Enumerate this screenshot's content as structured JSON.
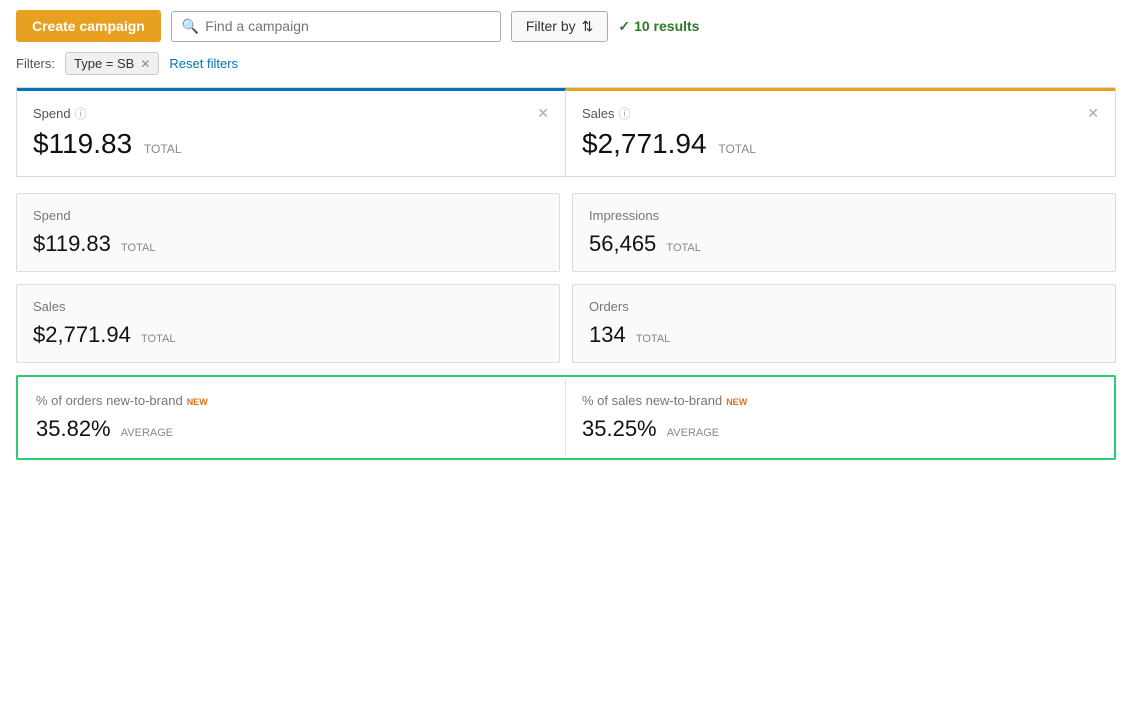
{
  "topbar": {
    "create_btn": "Create campaign",
    "search_placeholder": "Find a campaign",
    "filter_btn": "Filter by",
    "filter_icon": "⇅",
    "results_count": "10 results"
  },
  "filters": {
    "label": "Filters:",
    "active_filter": "Type = SB",
    "reset_label": "Reset filters"
  },
  "summary_cards": [
    {
      "title": "Spend",
      "value": "$119.83",
      "unit": "TOTAL"
    },
    {
      "title": "Sales",
      "value": "$2,771.94",
      "unit": "TOTAL"
    }
  ],
  "metric_cards": [
    {
      "title": "Spend",
      "value": "$119.83",
      "unit": "TOTAL"
    },
    {
      "title": "Impressions",
      "value": "56,465",
      "unit": "TOTAL"
    },
    {
      "title": "Sales",
      "value": "$2,771.94",
      "unit": "TOTAL"
    },
    {
      "title": "Orders",
      "value": "134",
      "unit": "TOTAL"
    }
  ],
  "ntb_cards": [
    {
      "title": "% of orders new-to-brand",
      "badge": "NEW",
      "value": "35.82%",
      "unit": "AVERAGE"
    },
    {
      "title": "% of sales new-to-brand",
      "badge": "NEW",
      "value": "35.25%",
      "unit": "AVERAGE"
    }
  ],
  "colors": {
    "create_btn": "#e8a020",
    "spend_bar": "#0073bb",
    "sales_bar": "#e8a020",
    "results_green": "#2a7a2a",
    "ntb_border": "#2ecc71",
    "new_badge": "#e07020"
  }
}
